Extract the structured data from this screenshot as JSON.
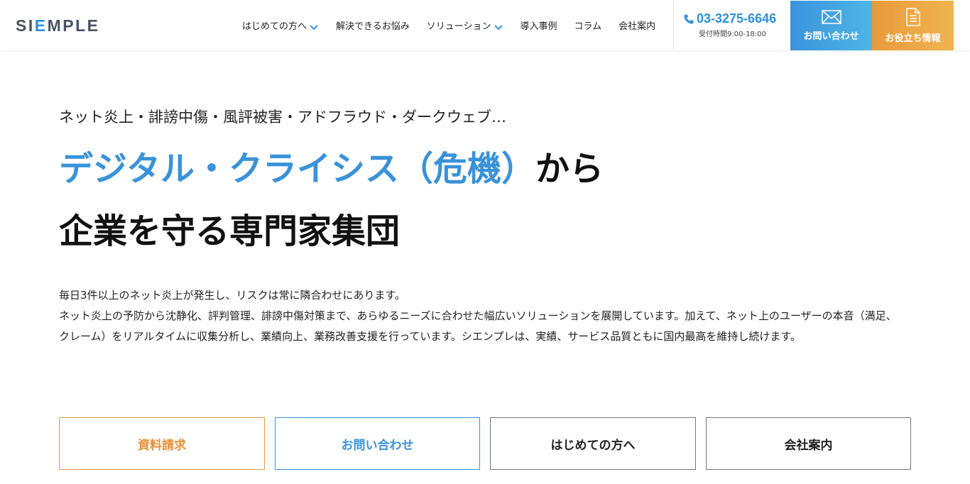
{
  "brand": {
    "logo_part1": "SI",
    "logo_part2": "E",
    "logo_part3": "MPLE"
  },
  "nav": [
    {
      "label": "はじめての方へ",
      "dropdown": true
    },
    {
      "label": "解決できるお悩み",
      "dropdown": false
    },
    {
      "label": "ソリューション",
      "dropdown": true
    },
    {
      "label": "導入事例",
      "dropdown": false
    },
    {
      "label": "コラム",
      "dropdown": false
    },
    {
      "label": "会社案内",
      "dropdown": false
    }
  ],
  "phone": {
    "number": "03-3275-6646",
    "hours": "受付時間9:00-18:00"
  },
  "cta": {
    "contact_label": "お問い合わせ",
    "info_label": "お役立ち情報"
  },
  "hero": {
    "sub": "ネット炎上・誹謗中傷・風評被害・アドフラウド・ダークウェブ…",
    "title_blue": "デジタル・クライシス（危機）",
    "title_black": "から",
    "title_line2": "企業を守る専門家集団",
    "desc_line1": "毎日3件以上のネット炎上が発生し、リスクは常に隣合わせにあります。",
    "desc_line2": "ネット炎上の予防から沈静化、評判管理、誹謗中傷対策まで、あらゆるニーズに合わせた幅広いソリューションを展開しています。加えて、ネット上のユーザーの本音（満足、クレーム）をリアルタイムに収集分析し、業績向上、業務改善支援を行っています。シエンプレは、実績、サービス品質ともに国内最高を維持し続けます。"
  },
  "buttons": {
    "request": "資料請求",
    "contact": "お問い合わせ",
    "beginner": "はじめての方へ",
    "company": "会社案内"
  },
  "colors": {
    "brand_blue": "#3a92d9",
    "brand_orange": "#e89a3c",
    "logo_gray": "#4a5461"
  }
}
